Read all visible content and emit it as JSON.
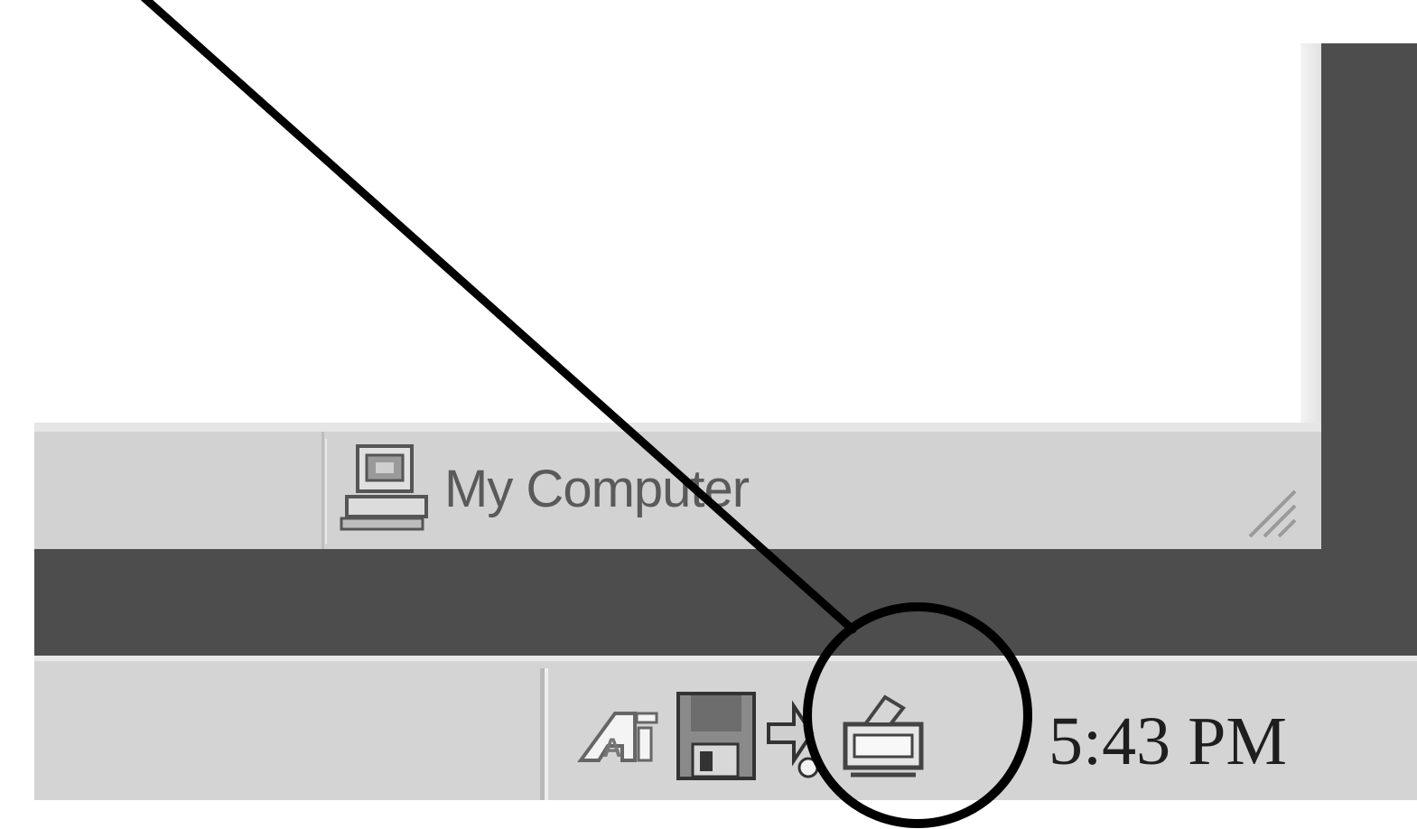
{
  "status_bar": {
    "location_text": "My Computer",
    "location_icon": "my-computer-icon"
  },
  "tray": {
    "icons": [
      "ati-icon",
      "floppy-disk-icon",
      "network-icon",
      "removable-device-icon"
    ],
    "clock": "5:43 PM"
  },
  "callout": {
    "target": "removable-device-icon"
  },
  "colors": {
    "taskbar": "#d4d4d4",
    "desktop": "#4d4d4d",
    "callout": "#000000"
  }
}
